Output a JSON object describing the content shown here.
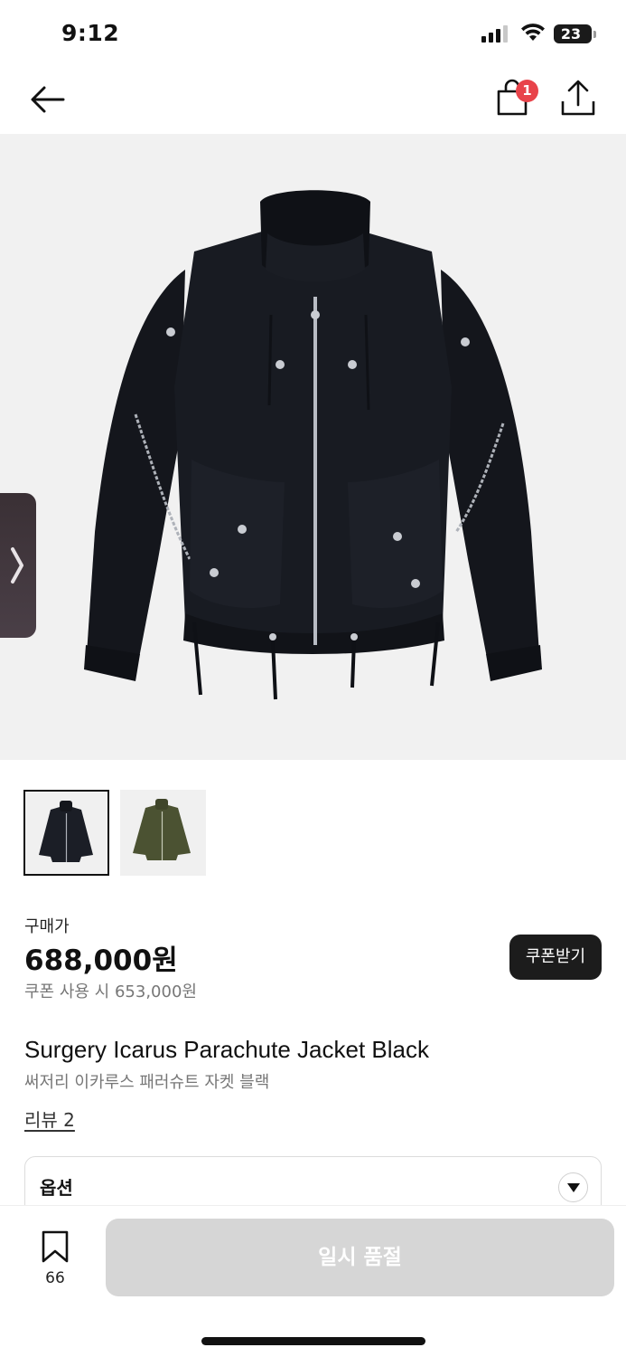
{
  "status_bar": {
    "time": "9:12",
    "battery_level": "23",
    "icons": [
      "signal-icon",
      "wifi-icon",
      "battery-icon"
    ]
  },
  "nav": {
    "icons": [
      "back-arrow-icon",
      "shopping-bag-icon",
      "share-icon"
    ],
    "cart_badge_count": "1"
  },
  "product": {
    "image_subject": "black parachute jacket",
    "thumbnails": [
      {
        "color": "#1b1e26",
        "selected": true
      },
      {
        "color": "#4b5232",
        "selected": false
      }
    ],
    "price_label": "구매가",
    "price": "688,000원",
    "coupon_price": "쿠폰 사용 시 653,000원",
    "coupon_button": "쿠폰받기",
    "name": "Surgery Icarus Parachute Jacket Black",
    "name_ko": "써저리 이카루스 패러슈트 자켓 블랙",
    "review_link": "리뷰 2"
  },
  "option": {
    "label": "옵션",
    "icon": "chevron-down-icon"
  },
  "bottom_bar": {
    "bookmark_icon": "bookmark-icon",
    "bookmark_count": "66",
    "soldout_button": "일시 품절"
  },
  "colors": {
    "badge": "#e8434a",
    "coupon_button_bg": "#1c1c1c",
    "soldout_button_bg": "#d6d6d6",
    "image_bg": "#f1f1f1"
  }
}
